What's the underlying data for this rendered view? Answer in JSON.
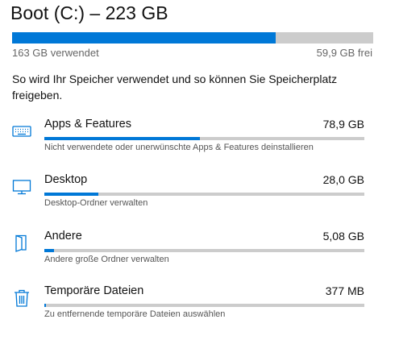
{
  "drive": {
    "title": "Boot (C:) – 223 GB",
    "used_label": "163 GB verwendet",
    "free_label": "59,9 GB frei",
    "used_fraction": 0.73,
    "accent_color": "#0078d7",
    "track_color": "#cccccc"
  },
  "description": "So wird Ihr Speicher verwendet und so können Sie Speicherplatz freigeben.",
  "categories": [
    {
      "icon": "keyboard-icon",
      "name": "Apps & Features",
      "size": "78,9 GB",
      "fraction": 0.485,
      "subtitle": "Nicht verwendete oder unerwünschte Apps & Features deinstallieren"
    },
    {
      "icon": "monitor-icon",
      "name": "Desktop",
      "size": "28,0 GB",
      "fraction": 0.17,
      "subtitle": "Desktop-Ordner verwalten"
    },
    {
      "icon": "folder-icon",
      "name": "Andere",
      "size": "5,08 GB",
      "fraction": 0.03,
      "subtitle": "Andere große Ordner verwalten"
    },
    {
      "icon": "trash-icon",
      "name": "Temporäre Dateien",
      "size": "377 MB",
      "fraction": 0.004,
      "subtitle": "Zu entfernende temporäre Dateien auswählen"
    }
  ]
}
